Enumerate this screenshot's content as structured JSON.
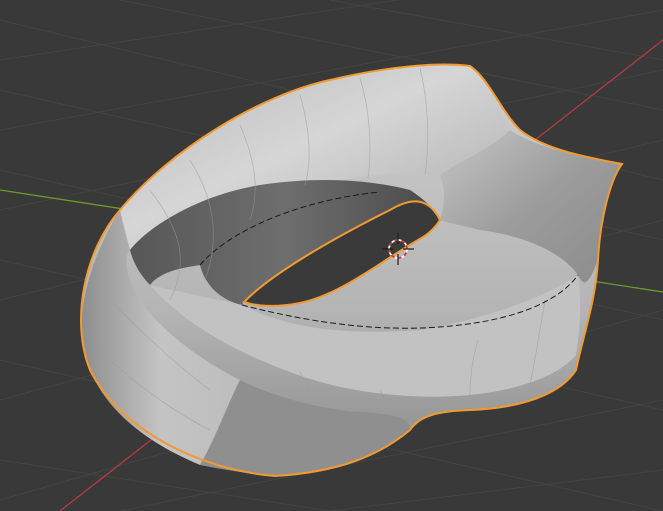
{
  "app": {
    "name": "",
    "area": "3D Viewport"
  },
  "viewport": {
    "background": "#393939",
    "grid_line_color": "#444444",
    "x_axis_color": "#b43a42",
    "y_axis_color": "#6f9a2c",
    "selected_outline_color": "#f19a32",
    "object": {
      "name": "",
      "shape": "mobius-strip-like twisted band",
      "selected": true,
      "shading": "solid",
      "material_color": "#c9c9c9"
    },
    "cursor_3d": {
      "visible": true,
      "icon": "crosshair-icon"
    }
  }
}
